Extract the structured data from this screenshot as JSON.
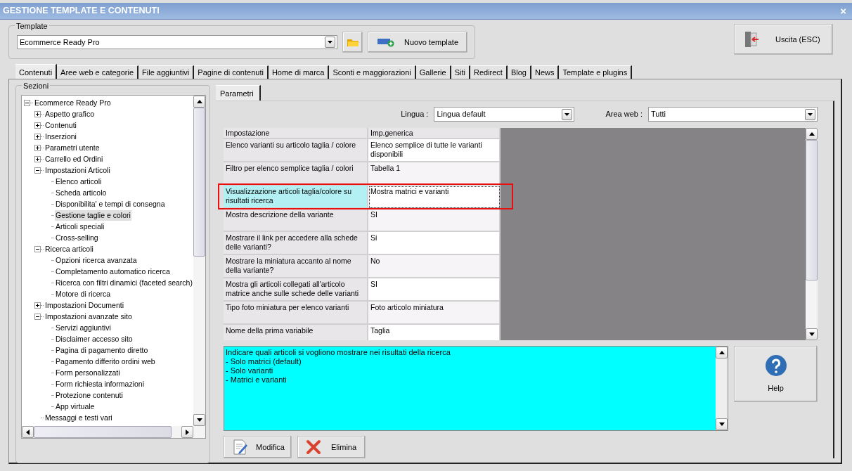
{
  "window": {
    "title": "GESTIONE TEMPLATE E CONTENUTI",
    "close": "×"
  },
  "template": {
    "legend": "Template",
    "value": "Ecommerce Ready Pro",
    "new_button": "Nuovo template"
  },
  "exit_button": "Uscita (ESC)",
  "tabs": [
    {
      "label": "Contenuti",
      "selected": true
    },
    {
      "label": "Aree web e categorie",
      "selected": false
    },
    {
      "label": "File aggiuntivi",
      "selected": false
    },
    {
      "label": "Pagine di contenuti",
      "selected": false
    },
    {
      "label": "Home di marca",
      "selected": false
    },
    {
      "label": "Sconti e maggiorazioni",
      "selected": false
    },
    {
      "label": "Gallerie",
      "selected": false
    },
    {
      "label": "Siti",
      "selected": false
    },
    {
      "label": "Redirect",
      "selected": false
    },
    {
      "label": "Blog",
      "selected": false
    },
    {
      "label": "News",
      "selected": false
    },
    {
      "label": "Template e plugins",
      "selected": false
    }
  ],
  "sections": {
    "legend": "Sezioni",
    "tree": [
      {
        "label": "Ecommerce Ready Pro",
        "kind": "folder",
        "expanded": true,
        "selected": false,
        "children": [
          {
            "label": "Aspetto grafico",
            "kind": "folder",
            "expanded": false,
            "selected": false
          },
          {
            "label": "Contenuti",
            "kind": "folder",
            "expanded": false,
            "selected": false
          },
          {
            "label": "Inserzioni",
            "kind": "folder",
            "expanded": false,
            "selected": false
          },
          {
            "label": "Parametri utente",
            "kind": "folder",
            "expanded": false,
            "selected": false
          },
          {
            "label": "Carrello ed Ordini",
            "kind": "folder",
            "expanded": false,
            "selected": false
          },
          {
            "label": "Impostazioni Articoli",
            "kind": "folder",
            "expanded": true,
            "selected": false,
            "children": [
              {
                "label": "Elenco articoli",
                "kind": "leaf",
                "selected": false
              },
              {
                "label": "Scheda articolo",
                "kind": "leaf",
                "selected": false
              },
              {
                "label": "Disponibilita' e tempi di consegna",
                "kind": "leaf",
                "selected": false
              },
              {
                "label": "Gestione taglie e colori",
                "kind": "leaf",
                "selected": true
              },
              {
                "label": "Articoli speciali",
                "kind": "leaf",
                "selected": false
              },
              {
                "label": "Cross-selling",
                "kind": "leaf",
                "selected": false
              }
            ]
          },
          {
            "label": "Ricerca articoli",
            "kind": "folder",
            "expanded": true,
            "selected": false,
            "children": [
              {
                "label": "Opzioni ricerca avanzata",
                "kind": "leaf",
                "selected": false
              },
              {
                "label": "Completamento automatico ricerca",
                "kind": "leaf",
                "selected": false
              },
              {
                "label": "Ricerca con filtri dinamici (faceted search)",
                "kind": "leaf",
                "selected": false
              },
              {
                "label": "Motore di ricerca",
                "kind": "leaf",
                "selected": false
              }
            ]
          },
          {
            "label": "Impostazioni Documenti",
            "kind": "folder",
            "expanded": false,
            "selected": false
          },
          {
            "label": "Impostazioni avanzate sito",
            "kind": "folder",
            "expanded": true,
            "selected": false,
            "children": [
              {
                "label": "Servizi aggiuntivi",
                "kind": "leaf",
                "selected": false
              },
              {
                "label": "Disclaimer accesso sito",
                "kind": "leaf",
                "selected": false
              },
              {
                "label": "Pagina di pagamento diretto",
                "kind": "leaf",
                "selected": false
              },
              {
                "label": "Pagamento differito ordini web",
                "kind": "leaf",
                "selected": false
              },
              {
                "label": "Form personalizzati",
                "kind": "leaf",
                "selected": false
              },
              {
                "label": "Form richiesta informazioni",
                "kind": "leaf",
                "selected": false
              },
              {
                "label": "Protezione contenuti",
                "kind": "leaf",
                "selected": false
              },
              {
                "label": "App virtuale",
                "kind": "leaf",
                "selected": false
              }
            ]
          },
          {
            "label": "Messaggi e testi vari",
            "kind": "leaf",
            "selected": false
          }
        ]
      }
    ]
  },
  "params_tab": "Parametri",
  "filters": [
    {
      "label": "Lingua :",
      "value": "Lingua default"
    },
    {
      "label": "Area web :",
      "value": "Tutti"
    }
  ],
  "table": {
    "columns": [
      "Impostazione",
      "Imp.generica"
    ],
    "rows": [
      {
        "setting": "Elenco varianti su articolo taglia / colore",
        "value": "Elenco semplice di tutte le varianti disponibili",
        "selected": false
      },
      {
        "setting": "Filtro per elenco semplice taglia / colori",
        "value": "Tabella 1",
        "selected": false
      },
      {
        "setting": "Visualizzazione articoli taglia/colore su risultati ricerca",
        "value": "Mostra matrici e varianti",
        "selected": true
      },
      {
        "setting": "Mostra descrizione della variante",
        "value": "SI",
        "selected": false
      },
      {
        "setting": "Mostrare il link per accedere alla schede delle varianti?",
        "value": "Si",
        "selected": false
      },
      {
        "setting": "Mostrare la miniatura accanto al nome della variante?",
        "value": "No",
        "selected": false
      },
      {
        "setting": "Mostra gli articoli collegati all'articolo matrice anche sulle schede delle varianti",
        "value": "SI",
        "selected": false
      },
      {
        "setting": "Tipo foto miniatura per elenco varianti",
        "value": "Foto articolo miniatura",
        "selected": false
      },
      {
        "setting": "Nome della prima variabile",
        "value": "Taglia",
        "selected": false
      }
    ]
  },
  "description": [
    "Indicare quali articoli si vogliono mostrare nei risultati della ricerca",
    "- Solo matrici (default)",
    "- Solo varianti",
    "- Matrici e varianti"
  ],
  "help_button": "Help",
  "actions": [
    {
      "label": "Modifica",
      "kind": "edit"
    },
    {
      "label": "Elimina",
      "kind": "delete"
    }
  ]
}
